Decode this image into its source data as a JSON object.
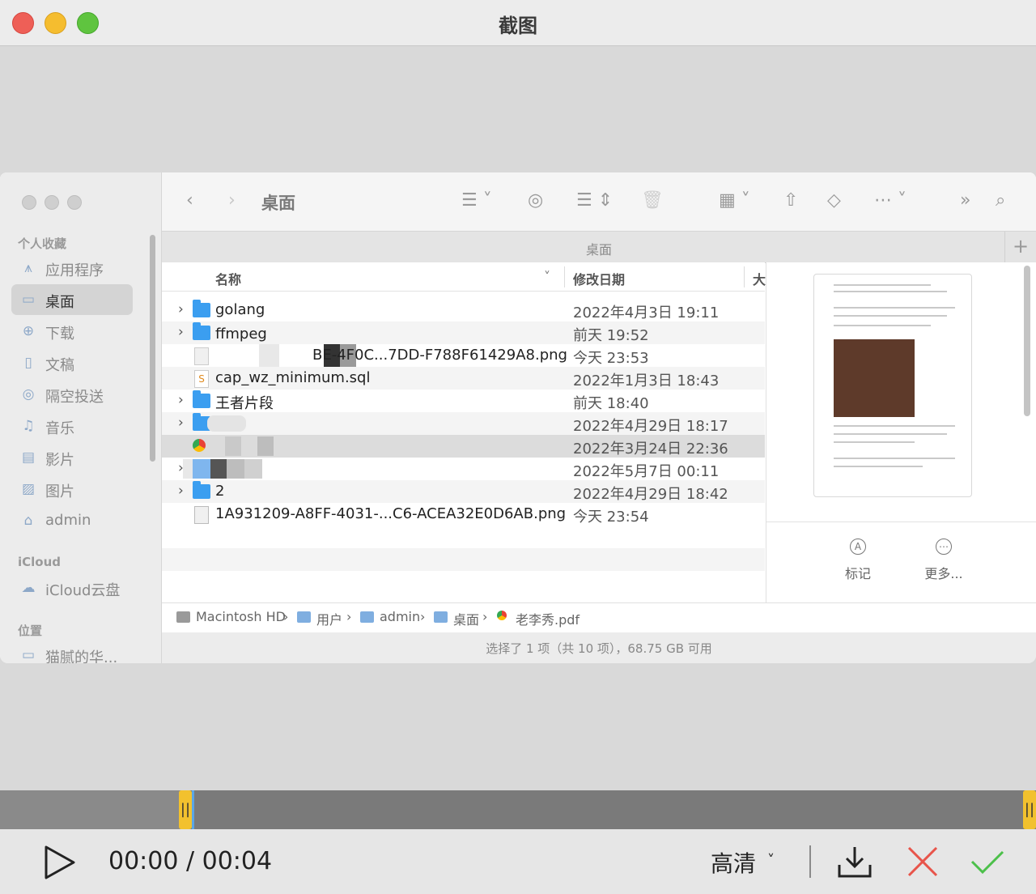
{
  "window": {
    "title": "截图"
  },
  "finder": {
    "folder_title": "桌面",
    "tab_label": "桌面",
    "tab_add": "+",
    "sidebar": {
      "favorites_header": "个人收藏",
      "favorites": [
        {
          "label": "应用程序",
          "icon": "apps-icon",
          "glyph": "⩚"
        },
        {
          "label": "桌面",
          "icon": "desktop-icon",
          "glyph": "▭",
          "selected": true
        },
        {
          "label": "下载",
          "icon": "download-icon",
          "glyph": "⊕"
        },
        {
          "label": "文稿",
          "icon": "document-icon",
          "glyph": "▯"
        },
        {
          "label": "隔空投送",
          "icon": "airdrop-icon",
          "glyph": "◎"
        },
        {
          "label": "音乐",
          "icon": "music-icon",
          "glyph": "♫"
        },
        {
          "label": "影片",
          "icon": "movie-icon",
          "glyph": "▤"
        },
        {
          "label": "图片",
          "icon": "picture-icon",
          "glyph": "▨"
        },
        {
          "label": "admin",
          "icon": "home-icon",
          "glyph": "⌂"
        }
      ],
      "icloud_header": "iCloud",
      "icloud_item": "iCloud云盘",
      "locations_header": "位置",
      "location_item": "猫腻的华..."
    },
    "columns": {
      "name": "名称",
      "date": "修改日期",
      "size": "大"
    },
    "files": [
      {
        "name": "golang",
        "date": "2022年4月3日 19:11",
        "type": "folder",
        "expandable": true
      },
      {
        "name": "ffmpeg",
        "date": "前天 19:52",
        "type": "folder",
        "expandable": true
      },
      {
        "name": "BE-4F0C...7DD-F788F61429A8.png",
        "date": "今天 23:53",
        "type": "image"
      },
      {
        "name": "cap_wz_minimum.sql",
        "date": "2022年1月3日 18:43",
        "type": "sql"
      },
      {
        "name": "王者片段",
        "date": "前天 18:40",
        "type": "folder",
        "expandable": true
      },
      {
        "name": "",
        "date": "2022年4月29日 18:17",
        "type": "folder",
        "expandable": true
      },
      {
        "name": "",
        "date": "2022年3月24日 22:36",
        "type": "pdf",
        "selected": true
      },
      {
        "name": "",
        "date": "2022年5月7日 00:11",
        "type": "folder",
        "expandable": true
      },
      {
        "name": "2",
        "date": "2022年4月29日 18:42",
        "type": "folder",
        "expandable": true
      },
      {
        "name": "1A931209-A8FF-4031-...C6-ACEA32E0D6AB.png",
        "date": "今天 23:54",
        "type": "image"
      }
    ],
    "preview": {
      "markup_label": "标记",
      "more_label": "更多..."
    },
    "pathbar": [
      "Macintosh HD",
      "用户",
      "admin",
      "桌面",
      "老李秀.pdf"
    ],
    "status": "选择了 1 项（共 10 项），68.75 GB 可用"
  },
  "player": {
    "time": "00:00 / 00:04",
    "quality": "高清",
    "progress_fraction": 0.0
  },
  "colors": {
    "close": "#ee5f57",
    "minimize": "#f5bd2f",
    "maximize": "#5fc43f",
    "folder": "#3b9ef0",
    "handle": "#f2c12e"
  }
}
